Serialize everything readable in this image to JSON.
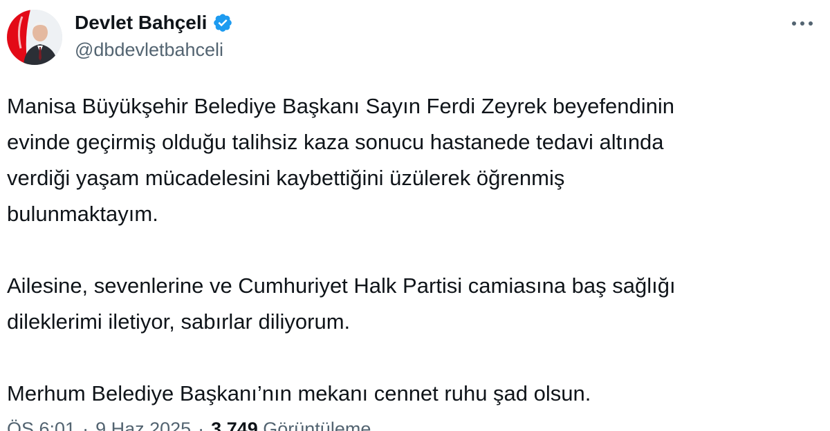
{
  "author": {
    "display_name": "Devlet Bahçeli",
    "handle": "@dbdevletbahceli",
    "verified": true,
    "avatar_icon": "profile-photo"
  },
  "header": {
    "more_icon": "more-horizontal-icon"
  },
  "post": {
    "paragraphs": [
      "Manisa Büyükşehir Belediye Başkanı Sayın Ferdi Zeyrek beyefendinin\nevinde geçirmiş olduğu talihsiz kaza sonucu hastanede tedavi altında\nverdiği yaşam mücadelesini kaybettiğini üzülerek öğrenmiş\nbulunmaktayım.",
      "Ailesine, sevenlerine ve Cumhuriyet Halk Partisi camiasına baş sağlığı\ndileklerimi iletiyor, sabırlar diliyorum.",
      "Merhum Belediye Başkanı’nın mekanı cennet ruhu şad olsun."
    ]
  },
  "meta": {
    "time": "ÖS 6:01",
    "separator1": "·",
    "date": "9 Haz 2025",
    "separator2": "·",
    "views_count": "3.749",
    "views_label": "Görüntüleme"
  },
  "colors": {
    "text_primary": "#0f1419",
    "text_secondary": "#536471",
    "verified_blue": "#1d9bf0",
    "avatar_flag_red": "#e30a17"
  }
}
